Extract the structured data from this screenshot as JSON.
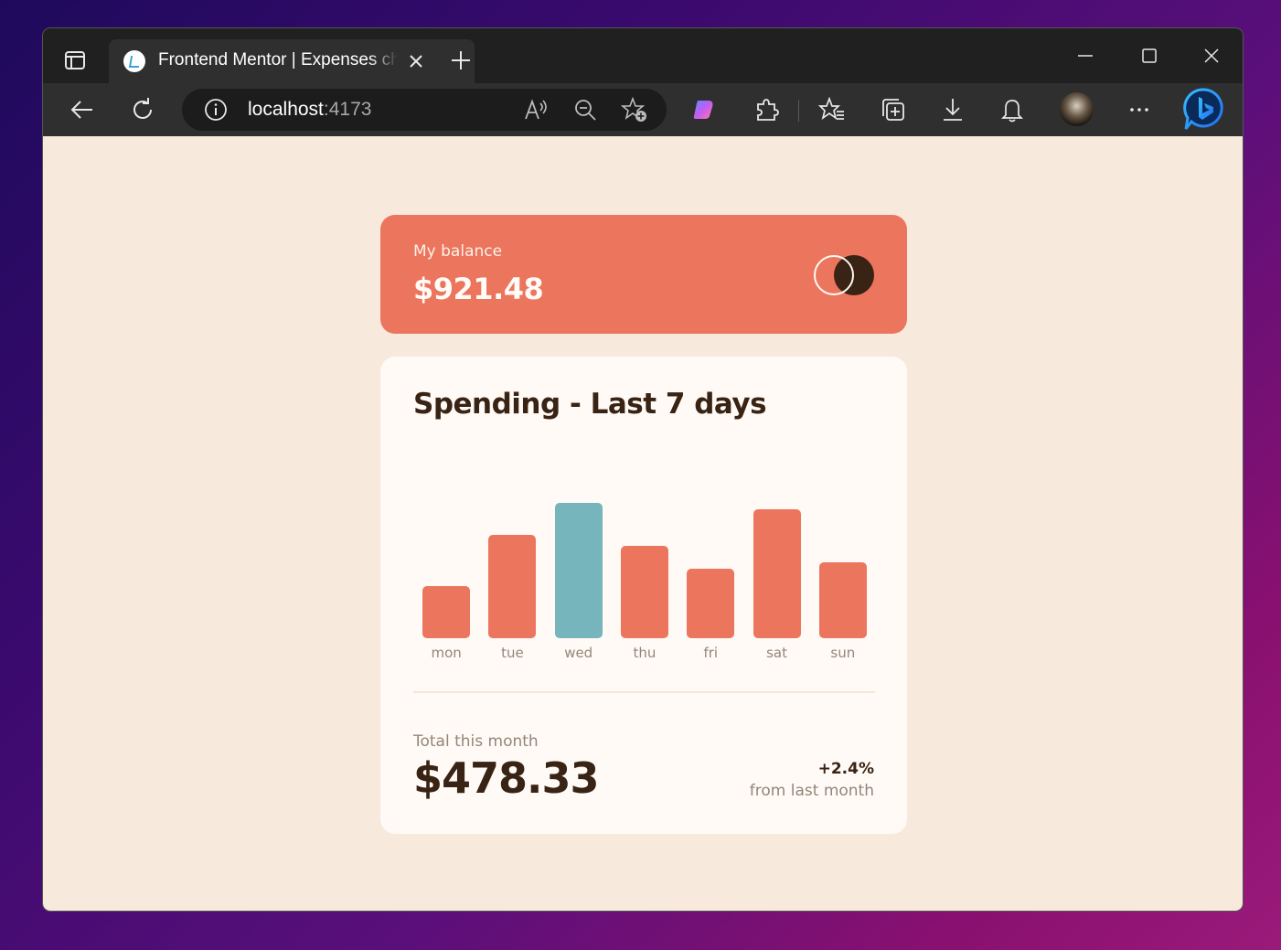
{
  "browser": {
    "tab_title": "Frontend Mentor | Expenses chart component",
    "url_host": "localhost",
    "url_port": ":4173",
    "icons": [
      "tab-actions-icon",
      "site-favicon",
      "close-icon",
      "new-tab-icon",
      "minimize-icon",
      "maximize-icon",
      "window-close-icon",
      "back-icon",
      "refresh-icon",
      "site-info-icon",
      "read-aloud-icon",
      "zoom-out-icon",
      "add-favorite-icon",
      "copilot-icon",
      "extensions-icon",
      "favorites-icon",
      "collections-icon",
      "downloads-icon",
      "notifications-icon",
      "profile-avatar",
      "more-icon",
      "bing-chat-icon"
    ]
  },
  "balance": {
    "label": "My balance",
    "value": "$921.48"
  },
  "spending": {
    "title": "Spending - Last 7 days",
    "total_label": "Total this month",
    "total_value": "$478.33",
    "change_value": "+2.4%",
    "change_label": "from last month"
  },
  "colors": {
    "accent": "#ec755d",
    "highlight": "#76b5bc",
    "dark": "#382314",
    "background": "#f7e9dc",
    "card": "#fffaf5"
  },
  "chart_data": {
    "type": "bar",
    "categories": [
      "mon",
      "tue",
      "wed",
      "thu",
      "fri",
      "sat",
      "sun"
    ],
    "values": [
      17.45,
      34.91,
      45.55,
      31.07,
      23.39,
      43.28,
      25.48
    ],
    "highlight_index": 2,
    "title": "Spending - Last 7 days",
    "xlabel": "",
    "ylabel": "",
    "ylim": [
      0,
      45.55
    ],
    "grid": false
  }
}
